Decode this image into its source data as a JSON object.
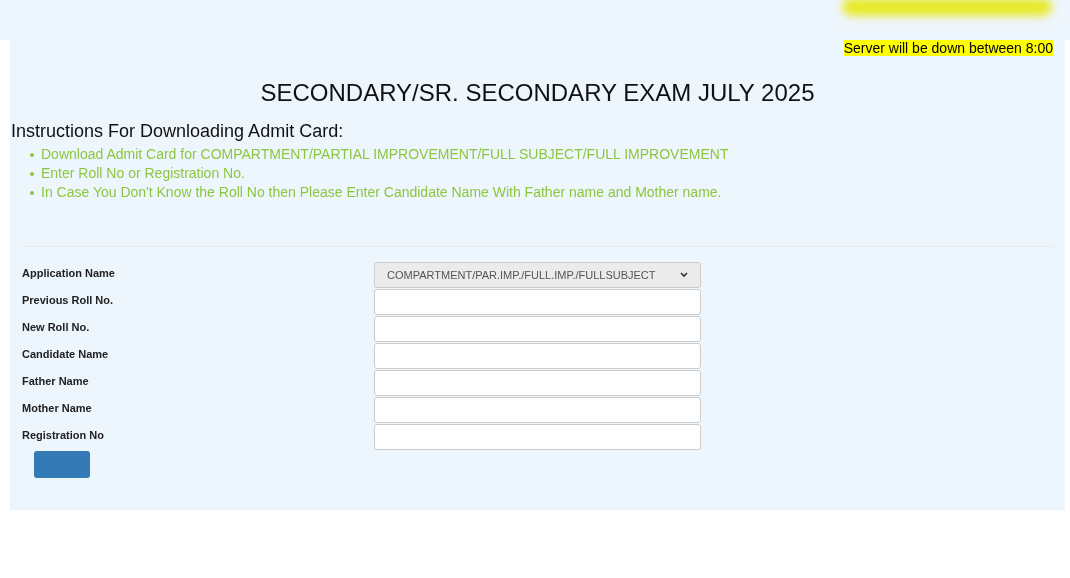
{
  "notice": "Server will be down between 8:00",
  "title": "SECONDARY/SR. SECONDARY EXAM JULY 2025",
  "instructions": {
    "heading": "Instructions For Downloading Admit Card:",
    "items": [
      "Download Admit Card for COMPARTMENT/PARTIAL IMPROVEMENT/FULL SUBJECT/FULL IMPROVEMENT",
      "Enter Roll No or Registration No.",
      "In Case You Don't Know the Roll No then Please Enter Candidate Name With Father name and Mother name."
    ]
  },
  "form": {
    "fields": [
      {
        "label": "Application Name",
        "kind": "select",
        "value": "COMPARTMENT/PAR.IMP./FULL.IMP./FULLSUBJECT"
      },
      {
        "label": "Previous Roll No.",
        "kind": "text"
      },
      {
        "label": "New Roll No.",
        "kind": "text"
      },
      {
        "label": "Candidate Name",
        "kind": "text"
      },
      {
        "label": "Father Name",
        "kind": "text"
      },
      {
        "label": "Mother Name",
        "kind": "text"
      },
      {
        "label": "Registration No",
        "kind": "text"
      }
    ]
  }
}
